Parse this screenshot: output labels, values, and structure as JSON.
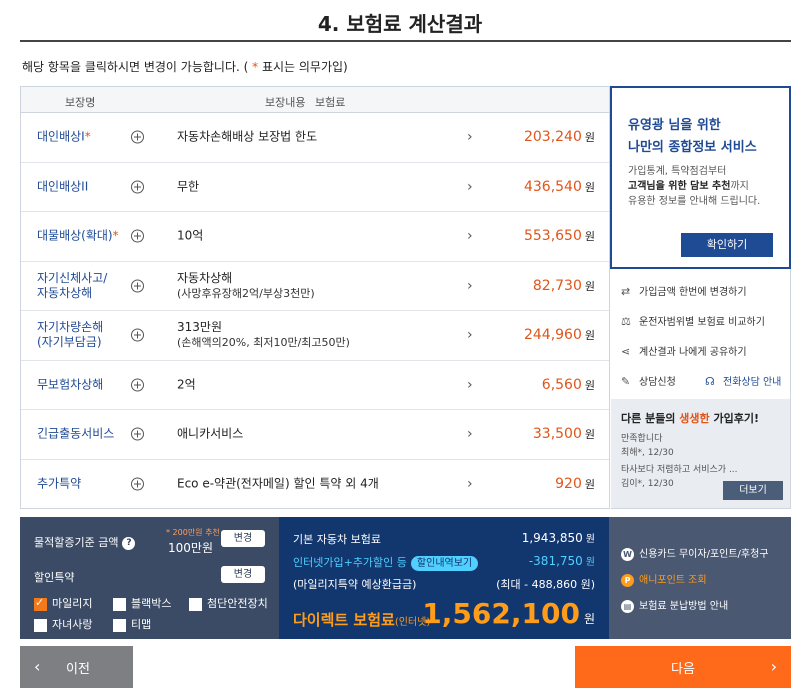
{
  "page": {
    "title": "4. 보험료 계산결과",
    "notice_prefix": "해당 항목을 클릭하시면 변경이 가능합니다. (",
    "notice_star": " * ",
    "notice_suffix": "표시는 의무가입)"
  },
  "table": {
    "headers": {
      "name": "보장명",
      "content": "보장내용",
      "premium": "보험료"
    },
    "rows": [
      {
        "name": "대인배상I",
        "required": "*",
        "content": "자동차손해배상 보장법 한도",
        "sub": "",
        "price": "203,240",
        "unit": "원"
      },
      {
        "name": "대인배상II",
        "required": "",
        "content": "무한",
        "sub": "",
        "price": "436,540",
        "unit": "원"
      },
      {
        "name": "대물배상(확대)",
        "required": "*",
        "content": "10억",
        "sub": "",
        "price": "553,650",
        "unit": "원"
      },
      {
        "name": "자기신체사고/",
        "name2": "자동차상해",
        "required": "",
        "content": "자동차상해",
        "sub": "(사망후유장해2억/부상3천만)",
        "price": "82,730",
        "unit": "원"
      },
      {
        "name": "자기차량손해",
        "name2": "(자기부담금)",
        "required": "",
        "content": "313만원",
        "sub": "(손해액의20%, 최저10만/최고50만)",
        "price": "244,960",
        "unit": "원"
      },
      {
        "name": "무보험차상해",
        "required": "",
        "content": "2억",
        "sub": "",
        "price": "6,560",
        "unit": "원"
      },
      {
        "name": "긴급출동서비스",
        "required": "",
        "content": "애니카서비스",
        "sub": "",
        "price": "33,500",
        "unit": "원"
      },
      {
        "name": "추가특약",
        "required": "",
        "content": "Eco e-약관(전자메일) 할인 특약 외 4개",
        "sub": "",
        "price": "920",
        "unit": "원"
      }
    ]
  },
  "promo": {
    "line1": "유영광 님을 위한",
    "line2": "나만의 종합정보 서비스",
    "desc1": "가입통계, 특약점검부터",
    "desc2_bold": "고객님을 위한 담보 추천",
    "desc2_rest": "까지",
    "desc3": "유용한 정보를 안내해 드립니다.",
    "button": "확인하기"
  },
  "side_links": [
    {
      "icon": "swap-icon",
      "label": "가입금액 한번에 변경하기"
    },
    {
      "icon": "scale-icon",
      "label": "운전자범위별 보험료 비교하기"
    },
    {
      "icon": "share-icon",
      "label": "계산결과 나에게 공유하기"
    },
    {
      "icon": "edit-icon",
      "label": "상담신청"
    },
    {
      "icon": "headset-icon",
      "label": "전화상담 안내"
    }
  ],
  "reviews": {
    "title_pre": "다른 분들의 ",
    "title_hl": "생생한",
    "title_post": " 가입후기!",
    "items": [
      {
        "text": "만족합니다",
        "meta": "최해*, 12/30"
      },
      {
        "text": "타사보다 저렴하고 서비스가 ...",
        "meta": "김이*, 12/30"
      }
    ],
    "more": "더보기"
  },
  "summary_left": {
    "mileage_label": "물적할증기준 금액",
    "recommend": "* 200만원 추천",
    "mileage_value": "100만원",
    "change": "변경",
    "discount_label": "할인특약",
    "change2": "변경",
    "options": [
      {
        "label": "마일리지",
        "checked": true
      },
      {
        "label": "블랙박스",
        "checked": false
      },
      {
        "label": "첨단안전장치",
        "checked": false
      },
      {
        "label": "자녀사랑",
        "checked": false
      },
      {
        "label": "티맵",
        "checked": false
      }
    ]
  },
  "summary_mid": {
    "base_label": "기본 자동차 보험료",
    "base_value": "1,943,850",
    "internet_label": "인터넷가입+추가할인 등",
    "detail_pill": "할인내역보기",
    "internet_value": "-381,750",
    "mileage_label": "(마일리지특약 예상환급금)",
    "mileage_value": "(최대 - 488,860 원)",
    "final_label": "다이렉트 보험료",
    "final_tag": "(인터넷)",
    "final_value": "1,562,100",
    "won": "원"
  },
  "summary_right": [
    {
      "icon": "W",
      "label": "신용카드 무이자/포인트/후청구",
      "orange": false
    },
    {
      "icon": "P",
      "label": "애니포인트 조회",
      "orange": true
    },
    {
      "icon": "▤",
      "label": "보험료 분납방법 안내",
      "orange": false
    }
  ],
  "nav": {
    "prev": "이전",
    "next": "다음"
  }
}
